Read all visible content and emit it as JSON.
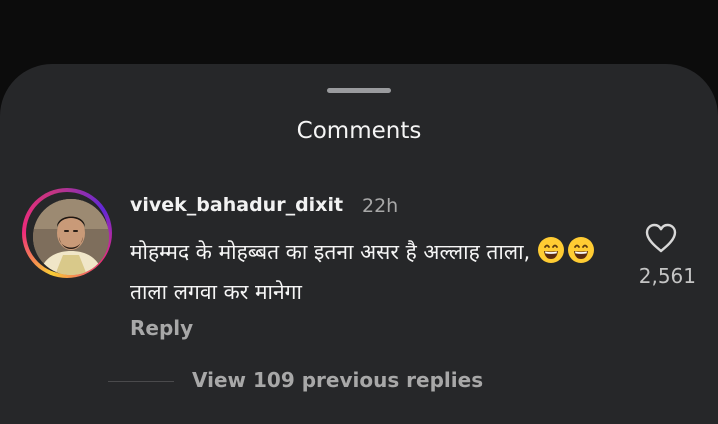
{
  "sheet": {
    "title": "Comments"
  },
  "comment": {
    "username": "vivek_bahadur_dixit",
    "time": "22h",
    "text_part1": "मोहम्मद के मोहब्बत का इतना असर है अल्लाह ताला,",
    "emojis": [
      "grinning-face",
      "grinning-face"
    ],
    "text_part2": "ताला लगवा कर मानेगा",
    "reply_label": "Reply",
    "like_count": "2,561",
    "liked": false
  },
  "replies": {
    "view_label": "View 109 previous replies"
  },
  "colors": {
    "sheet_background": "#262729",
    "page_background": "#0c0c0c",
    "primary_text": "#f5f5f5",
    "secondary_text": "#a8a8a8"
  }
}
